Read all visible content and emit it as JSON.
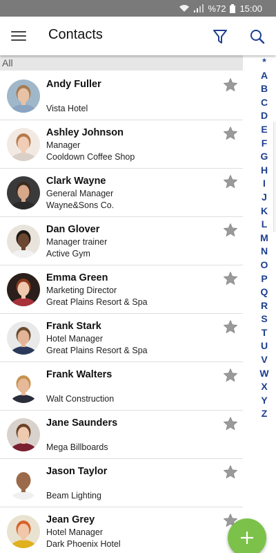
{
  "status_bar": {
    "battery": "%72",
    "time": "15:00"
  },
  "app_bar": {
    "title": "Contacts"
  },
  "section": {
    "label": "All"
  },
  "contacts": [
    {
      "name": "Andy Fuller",
      "title": "",
      "company": "Vista Hotel",
      "skin": "#e8c2a5",
      "hair": "#a67c52",
      "bg": "#9fb7c9",
      "shirt": "#8aa4c2"
    },
    {
      "name": "Ashley Johnson",
      "title": "Manager",
      "company": "Cooldown Coffee Shop",
      "skin": "#f0cdb4",
      "hair": "#b5784a",
      "bg": "#f2e9e3",
      "shirt": "#d9d0c8"
    },
    {
      "name": "Clark Wayne",
      "title": "General Manager",
      "company": "Wayne&Sons Co.",
      "skin": "#d6a889",
      "hair": "#3b2a20",
      "bg": "#3a3a3a",
      "shirt": "#2a2a2a"
    },
    {
      "name": "Dan Glover",
      "title": "Manager trainer",
      "company": "Active Gym",
      "skin": "#6b4630",
      "hair": "#1e1612",
      "bg": "#e8e4dc",
      "shirt": "#f2f2f2"
    },
    {
      "name": "Emma Green",
      "title": "Marketing Director",
      "company": "Great Plains Resort & Spa",
      "skin": "#f0c8ad",
      "hair": "#8a3a1e",
      "bg": "#2a1f1a",
      "shirt": "#a8323a"
    },
    {
      "name": "Frank Stark",
      "title": "Hotel Manager",
      "company": "Great Plains Resort & Spa",
      "skin": "#e3b596",
      "hair": "#6b4a2e",
      "bg": "#e9e9e9",
      "shirt": "#2b3a5a"
    },
    {
      "name": "Frank Walters",
      "title": "",
      "company": "Walt Construction",
      "skin": "#e6b998",
      "hair": "#c7924e",
      "bg": "#ffffff",
      "shirt": "#2a2d3a"
    },
    {
      "name": "Jane Saunders",
      "title": "",
      "company": "Mega Billboards",
      "skin": "#efcaae",
      "hair": "#6b4128",
      "bg": "#d9d2cc",
      "shirt": "#7a2030"
    },
    {
      "name": "Jason Taylor",
      "title": "",
      "company": "Beam Lighting",
      "skin": "#9a6a4a",
      "hair": "#9a6a4a",
      "bg": "#ffffff",
      "shirt": "#f0f0f0"
    },
    {
      "name": "Jean Grey",
      "title": "Hotel Manager",
      "company": "Dark Phoenix Hotel",
      "skin": "#f2c6a8",
      "hair": "#d6622a",
      "bg": "#e9e2d0",
      "shirt": "#e0b020"
    }
  ],
  "alphabet": [
    "*",
    "A",
    "B",
    "C",
    "D",
    "E",
    "F",
    "G",
    "H",
    "I",
    "J",
    "K",
    "L",
    "M",
    "N",
    "O",
    "P",
    "Q",
    "R",
    "S",
    "T",
    "U",
    "V",
    "W",
    "X",
    "Y",
    "Z"
  ],
  "icons": {
    "menu": "hamburger-menu-icon",
    "filter": "filter-icon",
    "search": "search-icon",
    "star": "star-outline-icon",
    "fab": "plus-icon"
  },
  "colors": {
    "accent": "#1e3f8f",
    "fab": "#7cc24a",
    "star": "#8f8f8f",
    "status_bar": "#7a7a7a",
    "section_header": "#e6e6e6"
  }
}
